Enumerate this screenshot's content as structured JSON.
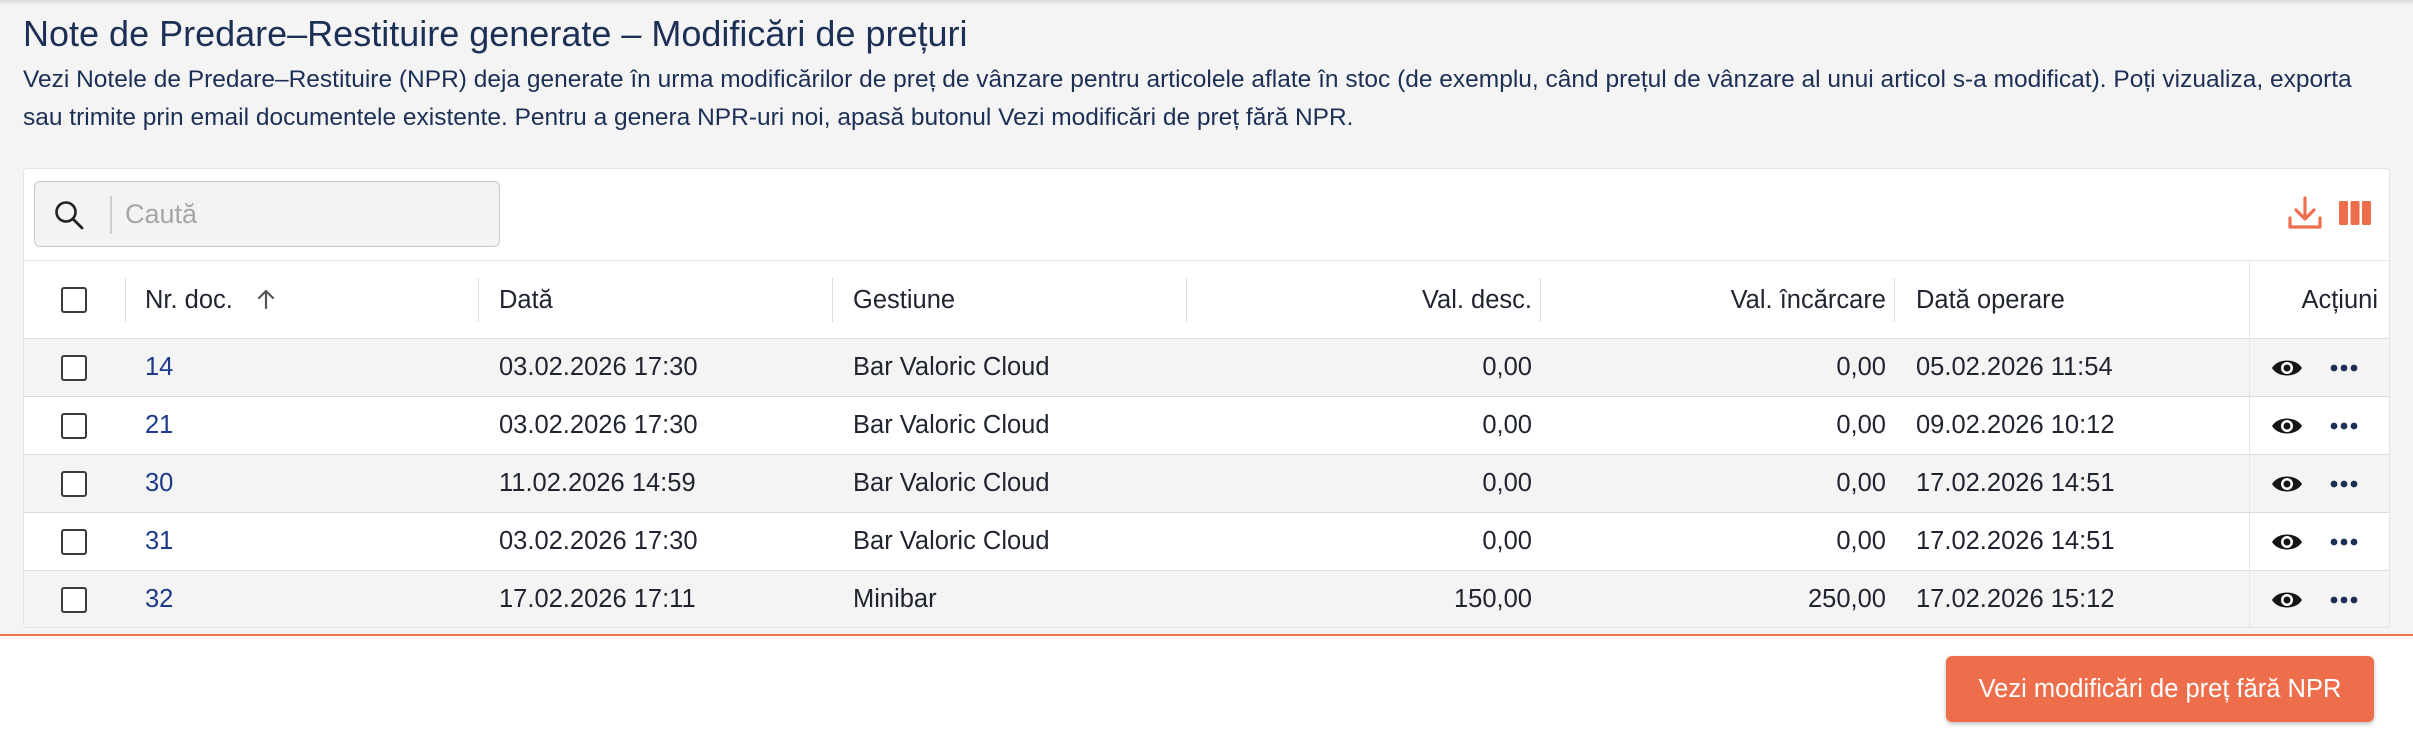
{
  "header": {
    "title": "Note de Predare–Restituire generate – Modificări de prețuri",
    "description": "Vezi Notele de Predare–Restituire (NPR) deja generate în urma modificărilor de preț de vânzare pentru articolele aflate în stoc (de exemplu, când prețul de vânzare al unui articol s-a modificat). Poți vizualiza, exporta sau trimite prin email documentele existente. Pentru a genera NPR-uri noi, apasă butonul Vezi modificări de preț fără NPR."
  },
  "toolbar": {
    "search_placeholder": "Caută",
    "search_value": "",
    "icons": [
      "search-icon",
      "download-icon",
      "columns-icon"
    ]
  },
  "table": {
    "columns": {
      "doc_no": "Nr. doc.",
      "date": "Dată",
      "store": "Gestiune",
      "val_desc": "Val. desc.",
      "val_inc": "Val. încărcare",
      "op_date": "Dată operare",
      "actions": "Acțiuni"
    },
    "sort": {
      "column": "Nr. doc.",
      "direction": "ascending"
    },
    "rows": [
      {
        "doc_no": "14",
        "date": "03.02.2026 17:30",
        "store": "Bar Valoric Cloud",
        "val_desc": "0,00",
        "val_inc": "0,00",
        "op_date": "05.02.2026 11:54"
      },
      {
        "doc_no": "21",
        "date": "03.02.2026 17:30",
        "store": "Bar Valoric Cloud",
        "val_desc": "0,00",
        "val_inc": "0,00",
        "op_date": "09.02.2026 10:12"
      },
      {
        "doc_no": "30",
        "date": "11.02.2026 14:59",
        "store": "Bar Valoric Cloud",
        "val_desc": "0,00",
        "val_inc": "0,00",
        "op_date": "17.02.2026 14:51"
      },
      {
        "doc_no": "31",
        "date": "03.02.2026 17:30",
        "store": "Bar Valoric Cloud",
        "val_desc": "0,00",
        "val_inc": "0,00",
        "op_date": "17.02.2026 14:51"
      },
      {
        "doc_no": "32",
        "date": "17.02.2026 17:11",
        "store": "Minibar",
        "val_desc": "150,00",
        "val_inc": "250,00",
        "op_date": "17.02.2026 15:12"
      }
    ],
    "row_actions": [
      "eye-icon",
      "more-icon"
    ]
  },
  "footer": {
    "primary_button": "Vezi modificări de preț fără NPR"
  },
  "colors": {
    "accent": "#ee6e4c",
    "title": "#1c2f55",
    "link": "#1e3a8a"
  }
}
